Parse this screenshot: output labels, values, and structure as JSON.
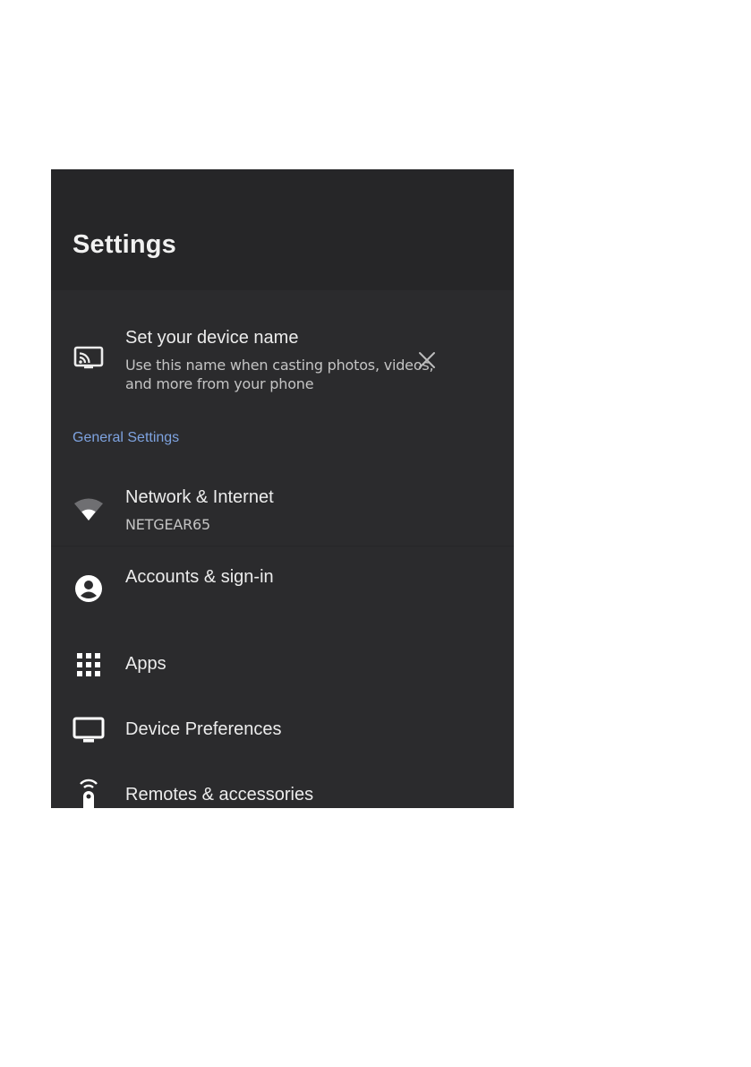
{
  "settings": {
    "title": "Settings"
  },
  "cast_suggestion": {
    "title": "Set your device name",
    "subtitle_line1": "Use this name when casting photos, videos,",
    "subtitle_line2": "and more from your phone"
  },
  "general": {
    "heading": "General Settings",
    "items": [
      {
        "label": "Network & Internet",
        "sub": "NETGEAR65",
        "icon": "wifi-icon"
      },
      {
        "label": "Accounts & sign-in",
        "icon": "account-circle-icon"
      },
      {
        "label": "Apps",
        "icon": "apps-grid-icon"
      },
      {
        "label": "Device Preferences",
        "icon": "tv-icon"
      },
      {
        "label": "Remotes & accessories",
        "icon": "remote-icon"
      }
    ]
  },
  "colors": {
    "panel_bg": "#2b2b2d",
    "header_bg": "#262628",
    "accent": "#7ea3e0",
    "text_primary": "#ececec",
    "text_secondary": "#c4c4c4"
  }
}
